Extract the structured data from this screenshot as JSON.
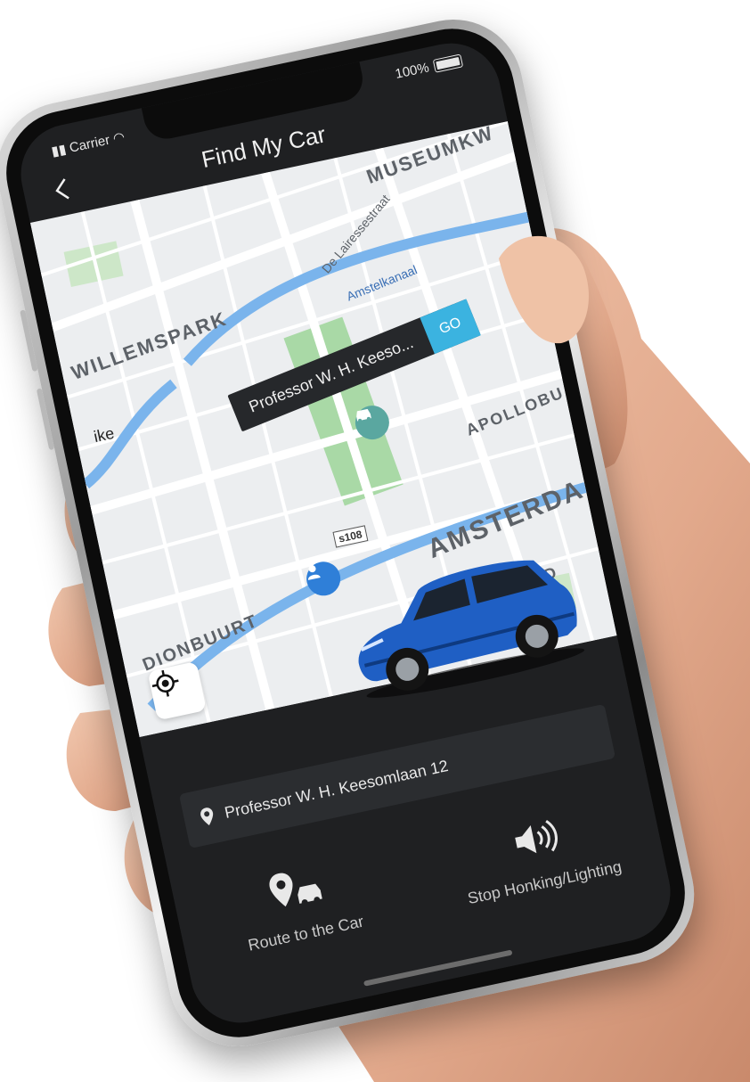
{
  "status": {
    "carrier": "Carrier",
    "battery": "100%"
  },
  "header": {
    "title": "Find My Car"
  },
  "map": {
    "labels": {
      "museum": "MUSEUMKW",
      "willemspark": "WILLEMSPARK",
      "lairessestraat": "De Lairessestraat",
      "amstelkanaal": "Amstelkanaal",
      "ike": "ike",
      "apollo": "APOLLOBU",
      "amsterdam": "AMSTERDA",
      "stadionbuurt": "DIONBUURT",
      "zuid": "-ZUID",
      "road": "s108"
    },
    "callout": {
      "text": "Professor W. H. Keeso...",
      "go_label": "GO"
    }
  },
  "panel": {
    "address": "Professor W. H. Keesomlaan 12",
    "actions": [
      {
        "label": "Route to the Car",
        "icon": "route-car-icon"
      },
      {
        "label": "Stop Honking/Lighting",
        "icon": "speaker-icon"
      }
    ]
  },
  "colors": {
    "accent": "#3bb3e0",
    "user_pin": "#2f7fd8",
    "car_pin": "#5aa7a0",
    "car_body": "#1f5fc4",
    "panel_bg": "#1f2022"
  }
}
